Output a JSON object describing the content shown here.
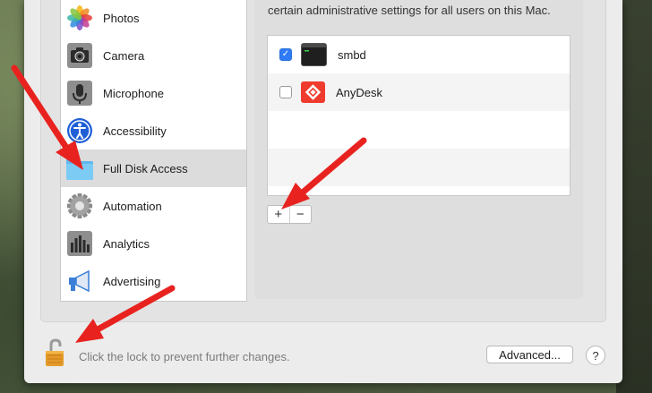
{
  "sidebar": {
    "items": [
      {
        "label": "Photos",
        "icon": "photos-icon"
      },
      {
        "label": "Camera",
        "icon": "camera-icon"
      },
      {
        "label": "Microphone",
        "icon": "microphone-icon"
      },
      {
        "label": "Accessibility",
        "icon": "accessibility-icon"
      },
      {
        "label": "Full Disk Access",
        "icon": "folder-icon",
        "selected": true
      },
      {
        "label": "Automation",
        "icon": "gear-icon"
      },
      {
        "label": "Analytics",
        "icon": "analytics-icon"
      },
      {
        "label": "Advertising",
        "icon": "megaphone-icon"
      }
    ]
  },
  "panel": {
    "description": "certain administrative settings for all users on this Mac.",
    "apps": [
      {
        "name": "smbd",
        "checked": true,
        "icon": "terminal-icon"
      },
      {
        "name": "AnyDesk",
        "checked": false,
        "icon": "anydesk-icon"
      }
    ],
    "add_label": "+",
    "remove_label": "−"
  },
  "footer": {
    "lock_text": "Click the lock to prevent further changes.",
    "advanced_label": "Advanced...",
    "help_label": "?"
  },
  "colors": {
    "accent": "#2f7bf5",
    "annotation_arrow": "#e8231f",
    "anydesk": "#ef3b2d"
  }
}
